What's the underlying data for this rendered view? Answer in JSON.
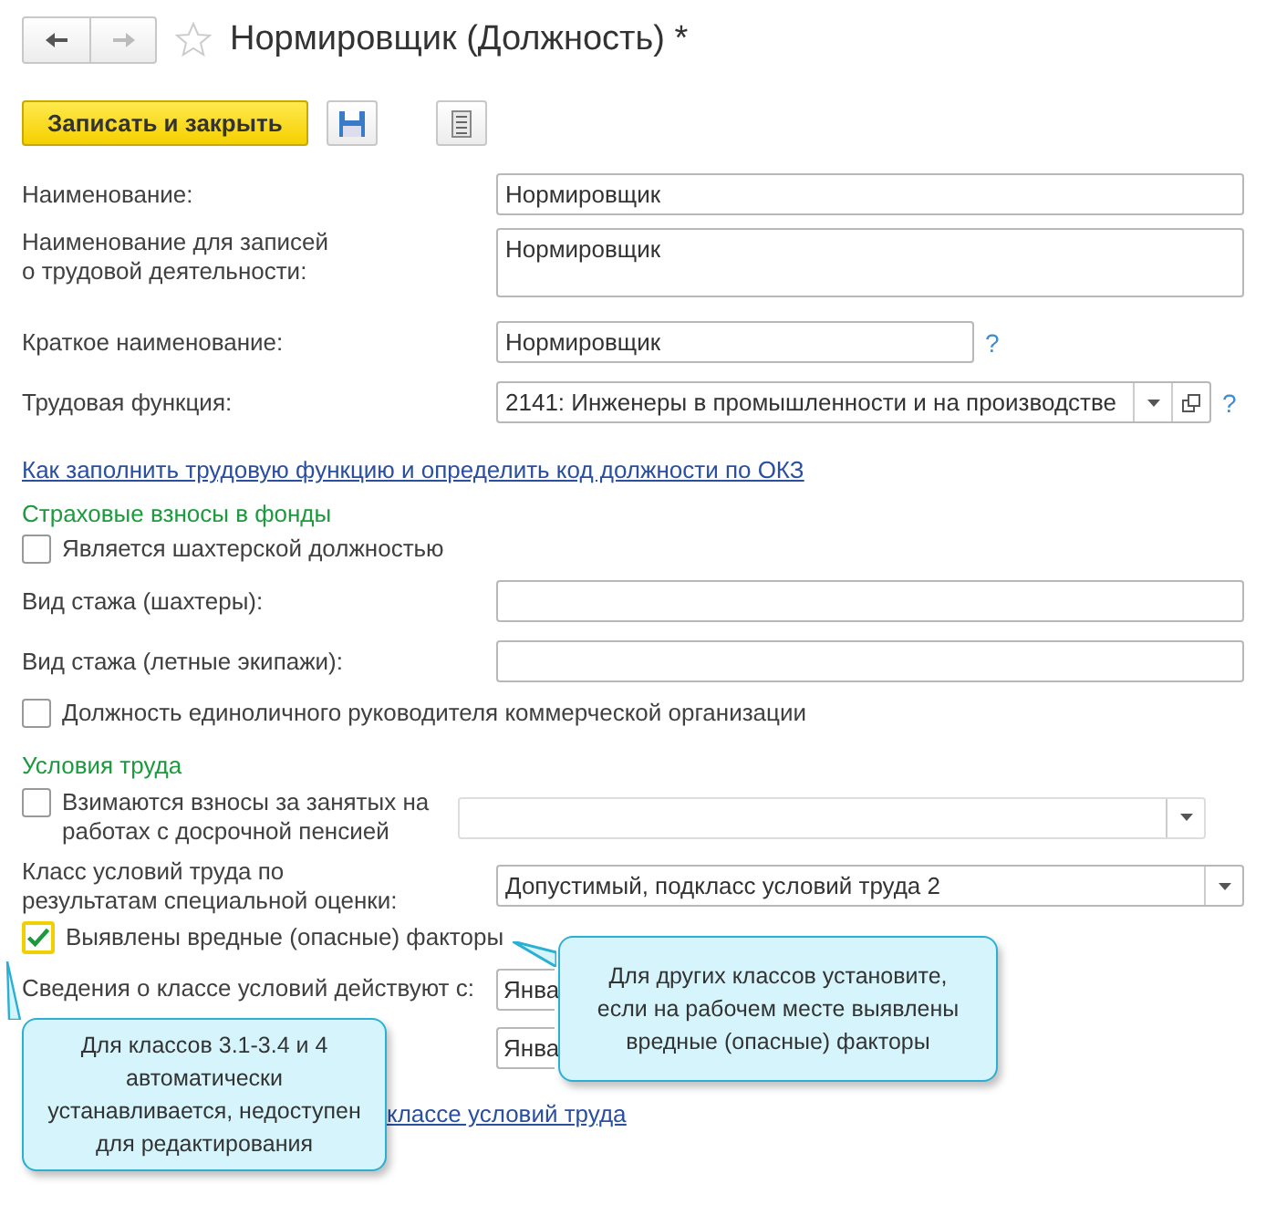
{
  "window": {
    "title": "Нормировщик (Должность) *"
  },
  "toolbar": {
    "primary_button": "Записать и закрыть"
  },
  "rows": [
    {
      "kind": "field",
      "label": "Наименование:",
      "value": "Нормировщик"
    },
    {
      "kind": "textarea",
      "label": "Наименование для записей\nо трудовой деятельности:",
      "value": "Нормировщик"
    },
    {
      "kind": "short_field",
      "label": "Краткое наименование:",
      "value": "Нормировщик",
      "help": "?"
    },
    {
      "kind": "select",
      "label": "Трудовая функция:",
      "value": "2141: Инженеры в промышленности и на производстве",
      "help": "?"
    },
    {
      "kind": "link",
      "text": "Как заполнить трудовую функцию и определить код должности по ОКЗ"
    },
    {
      "kind": "section",
      "text": "Страховые взносы в фонды"
    },
    {
      "kind": "checkbox",
      "label": "Является шахтерской должностью",
      "checked": false
    },
    {
      "kind": "field",
      "label": "Вид стажа (шахтеры):"
    },
    {
      "kind": "field",
      "label": "Вид стажа (летные экипажи):"
    },
    {
      "kind": "checkbox",
      "label": "Должность единоличного руководителя коммерческой организации",
      "checked": false
    },
    {
      "kind": "section",
      "text": "Условия труда"
    },
    {
      "kind": "checkbox_select",
      "label": "Взимаются взносы за занятых на\nработах с досрочной пенсией",
      "checked": false
    },
    {
      "kind": "select",
      "label": "Класс условий труда по\nрезультатам специальной оценки:",
      "value": "Допустимый, подкласс условий труда 2"
    },
    {
      "kind": "checkbox",
      "label": "Выявлены вредные (опасные) факторы",
      "checked": true,
      "focused": true
    },
    {
      "kind": "date",
      "label": "Сведения о классе условий действуют с:",
      "value": "Янва"
    },
    {
      "kind": "date",
      "value": "Янва"
    },
    {
      "kind": "link",
      "text": "классе условий труда"
    }
  ],
  "callouts": [
    {
      "kind": "pointer_left",
      "text": "Для других классов установите,\nесли на рабочем месте выявлены\nвредные (опасные) факторы"
    },
    {
      "kind": "pointer_up",
      "text": "Для классов 3.1-3.4 и 4\nавтоматически\nустанавливается, недоступен\nдля редактирования"
    }
  ]
}
